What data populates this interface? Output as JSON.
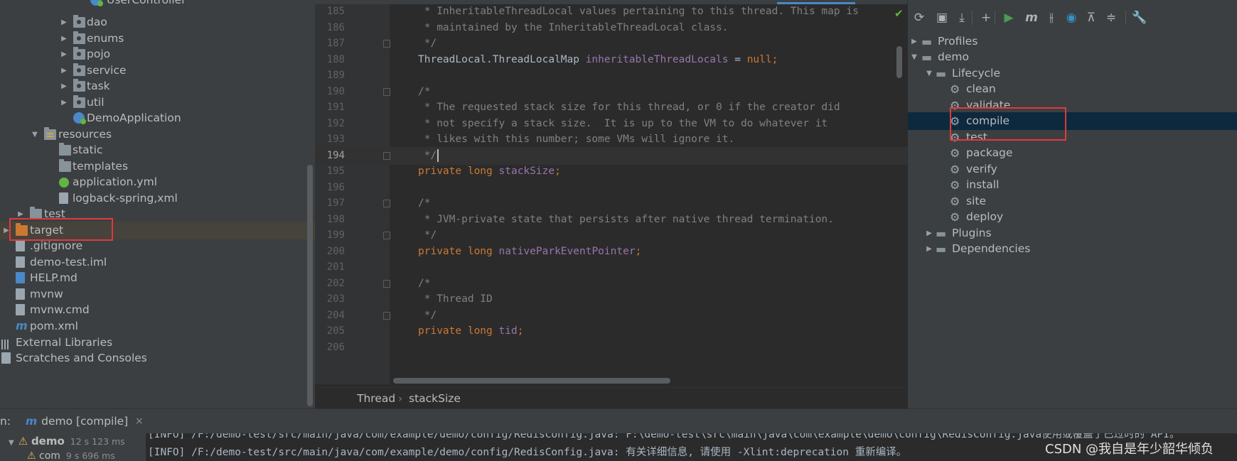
{
  "project_tree": [
    {
      "label": "UserController",
      "kind": "class",
      "indent": 0
    },
    {
      "label": "dao",
      "kind": "package"
    },
    {
      "label": "enums",
      "kind": "package"
    },
    {
      "label": "pojo",
      "kind": "package"
    },
    {
      "label": "service",
      "kind": "package"
    },
    {
      "label": "task",
      "kind": "package"
    },
    {
      "label": "util",
      "kind": "package"
    },
    {
      "label": "DemoApplication",
      "kind": "class"
    },
    {
      "label": "resources",
      "kind": "resources"
    },
    {
      "label": "static",
      "kind": "folder"
    },
    {
      "label": "templates",
      "kind": "folder"
    },
    {
      "label": "application.yml",
      "kind": "spring"
    },
    {
      "label": "logback-spring,xml",
      "kind": "xml"
    },
    {
      "label": "test",
      "kind": "folder"
    },
    {
      "label": "target",
      "kind": "excluded"
    },
    {
      "label": ".gitignore",
      "kind": "file"
    },
    {
      "label": "demo-test.iml",
      "kind": "file"
    },
    {
      "label": "HELP.md",
      "kind": "md"
    },
    {
      "label": "mvnw",
      "kind": "file"
    },
    {
      "label": "mvnw.cmd",
      "kind": "cmd"
    },
    {
      "label": "pom.xml",
      "kind": "maven"
    },
    {
      "label": "External Libraries",
      "kind": "libraries"
    },
    {
      "label": "Scratches and Consoles",
      "kind": "scratches"
    }
  ],
  "editor": {
    "lines": [
      {
        "n": "185",
        "text": " * InheritableThreadLocal values pertaining to this thread. This map is",
        "type": "comment"
      },
      {
        "n": "186",
        "text": " * maintained by the InheritableThreadLocal class.",
        "type": "comment"
      },
      {
        "n": "187",
        "text": " */",
        "type": "comment"
      },
      {
        "n": "188",
        "parts": [
          [
            "ThreadLocal.ThreadLocalMap ",
            "plain"
          ],
          [
            "inheritableThreadLocals",
            "field"
          ],
          [
            " = ",
            "plain"
          ],
          [
            "null",
            "kw"
          ],
          [
            ";",
            "kw"
          ]
        ]
      },
      {
        "n": "189",
        "text": "",
        "type": "plain"
      },
      {
        "n": "190",
        "text": "/*",
        "type": "comment"
      },
      {
        "n": "191",
        "text": " * The requested stack size for this thread, or 0 if the creator did",
        "type": "comment"
      },
      {
        "n": "192",
        "text": " * not specify a stack size.  It is up to the VM to do whatever it",
        "type": "comment"
      },
      {
        "n": "193",
        "text": " * likes with this number; some VMs will ignore it.",
        "type": "comment"
      },
      {
        "n": "194",
        "text": " */",
        "type": "comment",
        "current": true
      },
      {
        "n": "195",
        "parts": [
          [
            "private long ",
            "kw"
          ],
          [
            "stackSize",
            "field"
          ],
          [
            ";",
            "kw"
          ]
        ]
      },
      {
        "n": "196",
        "text": "",
        "type": "plain"
      },
      {
        "n": "197",
        "text": "/*",
        "type": "comment"
      },
      {
        "n": "198",
        "text": " * JVM-private state that persists after native thread termination.",
        "type": "comment"
      },
      {
        "n": "199",
        "text": " */",
        "type": "comment"
      },
      {
        "n": "200",
        "parts": [
          [
            "private long ",
            "kw"
          ],
          [
            "nativeParkEventPointer",
            "field"
          ],
          [
            ";",
            "kw"
          ]
        ]
      },
      {
        "n": "201",
        "text": "",
        "type": "plain"
      },
      {
        "n": "202",
        "text": "/*",
        "type": "comment"
      },
      {
        "n": "203",
        "text": " * Thread ID",
        "type": "comment"
      },
      {
        "n": "204",
        "text": " */",
        "type": "comment"
      },
      {
        "n": "205",
        "parts": [
          [
            "private long ",
            "kw"
          ],
          [
            "tid",
            "field"
          ],
          [
            ";",
            "kw"
          ]
        ]
      },
      {
        "n": "206",
        "text": "",
        "type": "plain"
      }
    ],
    "breadcrumb": [
      "Thread",
      "stackSize"
    ]
  },
  "maven": {
    "toolbar": [
      {
        "icon": "reload-icon",
        "glyph": "⟳"
      },
      {
        "icon": "generate-sources-icon",
        "glyph": "▣"
      },
      {
        "icon": "download-icon",
        "glyph": "⤓"
      },
      {
        "icon": "add-icon",
        "glyph": "+"
      },
      {
        "icon": "run-icon",
        "glyph": "▶"
      },
      {
        "icon": "execute-goal-icon",
        "glyph": "m"
      },
      {
        "icon": "skip-tests-icon",
        "glyph": "⫲"
      },
      {
        "icon": "offline-icon",
        "glyph": "◉"
      },
      {
        "icon": "show-dependencies-icon",
        "glyph": "⊼"
      },
      {
        "icon": "collapse-all-icon",
        "glyph": "≑"
      },
      {
        "icon": "settings-icon",
        "glyph": "🔧"
      }
    ],
    "tree": [
      {
        "label": "Profiles",
        "kind": "folder"
      },
      {
        "label": "demo",
        "kind": "project"
      },
      {
        "label": "Lifecycle",
        "kind": "folder"
      },
      {
        "label": "clean",
        "kind": "goal"
      },
      {
        "label": "validate",
        "kind": "goal"
      },
      {
        "label": "compile",
        "kind": "goal",
        "selected": true
      },
      {
        "label": "test",
        "kind": "goal"
      },
      {
        "label": "package",
        "kind": "goal"
      },
      {
        "label": "verify",
        "kind": "goal"
      },
      {
        "label": "install",
        "kind": "goal"
      },
      {
        "label": "site",
        "kind": "goal"
      },
      {
        "label": "deploy",
        "kind": "goal"
      },
      {
        "label": "Plugins",
        "kind": "folder"
      },
      {
        "label": "Dependencies",
        "kind": "folder"
      }
    ]
  },
  "run": {
    "prefix": "n:",
    "tab_label": "demo [compile]",
    "close_glyph": "×",
    "tree_root": "demo",
    "tree_root_time": "12 s 123 ms",
    "tree_child": "com",
    "tree_child_time": "9 s 696 ms",
    "console": [
      "[INFO] /F:/demo-test/src/main/java/com/example/demo/config/RedisConfig.java: F:\\demo-test\\src\\main\\java\\com\\example\\demo\\config\\RedisConfig.java使用或覆盖了已过时的 API。",
      "[INFO] /F:/demo-test/src/main/java/com/example/demo/config/RedisConfig.java: 有关详细信息, 请使用 -Xlint:deprecation 重新编译。"
    ]
  },
  "watermark": "CSDN @我自是年少韶华倾负",
  "colors": {
    "highlight_box": "#e0393e",
    "selection": "#0d293e",
    "keyword": "#cc7832",
    "field": "#9876aa",
    "comment": "#808080"
  }
}
